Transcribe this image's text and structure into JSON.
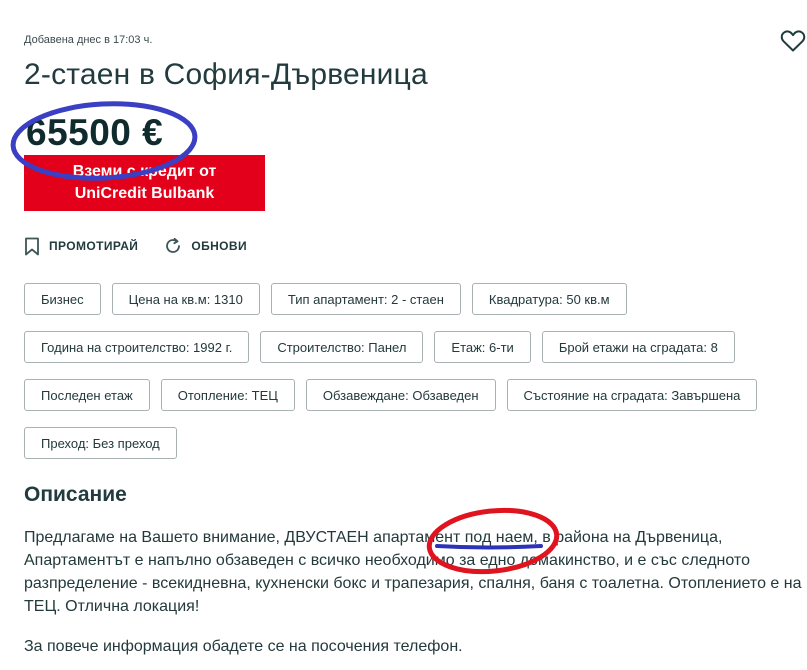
{
  "listing": {
    "added": "Добавена днес в 17:03 ч.",
    "title": "2-стаен в София-Дървеница",
    "price": "65500 €",
    "credit_line1": "Вземи с кредит от",
    "credit_line2": "UniCredit Bulbank",
    "favorite_icon": "heart-outline-icon"
  },
  "actions": {
    "promote": "ПРОМОТИРАЙ",
    "promote_icon": "bookmark-outline-icon",
    "refresh": "ОБНОВИ",
    "refresh_icon": "refresh-icon"
  },
  "chips": [
    "Бизнес",
    "Цена на кв.м: 1310",
    "Тип апартамент: 2 - стаен",
    "Квадратура: 50 кв.м",
    "Година на строителство: 1992 г.",
    "Строителство: Панел",
    "Етаж: 6-ти",
    "Брой етажи на сградата: 8",
    "Последен етаж",
    "Отопление: ТЕЦ",
    "Обзавеждане: Обзаведен",
    "Състояние на сградата: Завършена",
    "Преход: Без преход"
  ],
  "description": {
    "heading": "Описание",
    "part1": "Предлагаме на Вашето внимание, ДВУСТАЕН апартамент ",
    "highlight": "под наем",
    "part2": ", в района на Дървеница, Апартаментът е напълно обзаведен с всичко необходимо за едно домакинство, и е със следното разпределение - всекидневна, кухненски бокс и трапезария, спалня, баня с тоалетна. Отоплението е на ТЕЦ. Отлична локация!",
    "contact": "За повече информация обадете се на посочения телефон."
  },
  "annotation_colors": {
    "price_circle": "#3a3fc4",
    "text_circle": "#e0141e",
    "underline": "#2d33b8",
    "credit_banner": "#e2001a"
  }
}
